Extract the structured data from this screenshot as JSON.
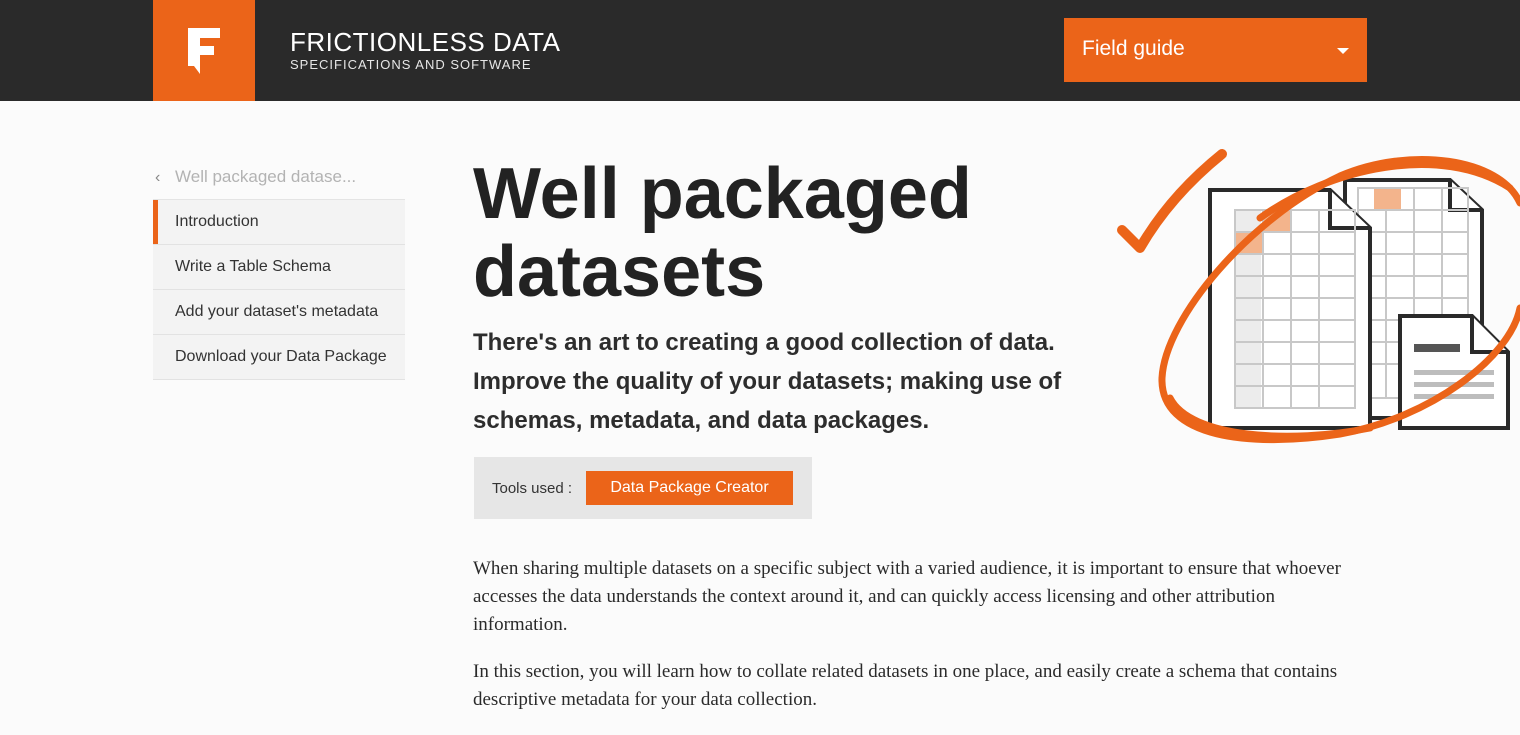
{
  "header": {
    "brand_title": "FRICTIONLESS DATA",
    "brand_subtitle": "SPECIFICATIONS AND SOFTWARE",
    "menu_label": "Field guide",
    "accent": "#eb6419",
    "bg": "#2a2a2a"
  },
  "sidebar": {
    "back_label": "Well packaged datase...",
    "items": [
      {
        "label": "Introduction",
        "active": true
      },
      {
        "label": "Write a Table Schema"
      },
      {
        "label": "Add your dataset's metadata"
      },
      {
        "label": "Download your Data Package"
      }
    ]
  },
  "main": {
    "title_line1": "Well packaged",
    "title_line2": "datasets",
    "lead": "There's an art to creating a good collection of data. Improve the quality of your datasets; making use of schemas, metadata, and data packages.",
    "tools_label": "Tools used :",
    "tools_button": "Data Package Creator",
    "paragraph1": "When sharing multiple datasets on a specific subject with a varied audience, it is important to ensure that whoever accesses the data understands the context around it, and can quickly access licensing and other attribution information.",
    "paragraph2": "In this section, you will learn how to collate related datasets in one place, and easily create a schema that contains descriptive metadata for your data collection."
  },
  "icons": {
    "logo": "frictionless-logo-icon",
    "dropdown": "caret-down-icon",
    "back": "chevron-left-icon",
    "illustration": "datasets-checked-illustration"
  }
}
